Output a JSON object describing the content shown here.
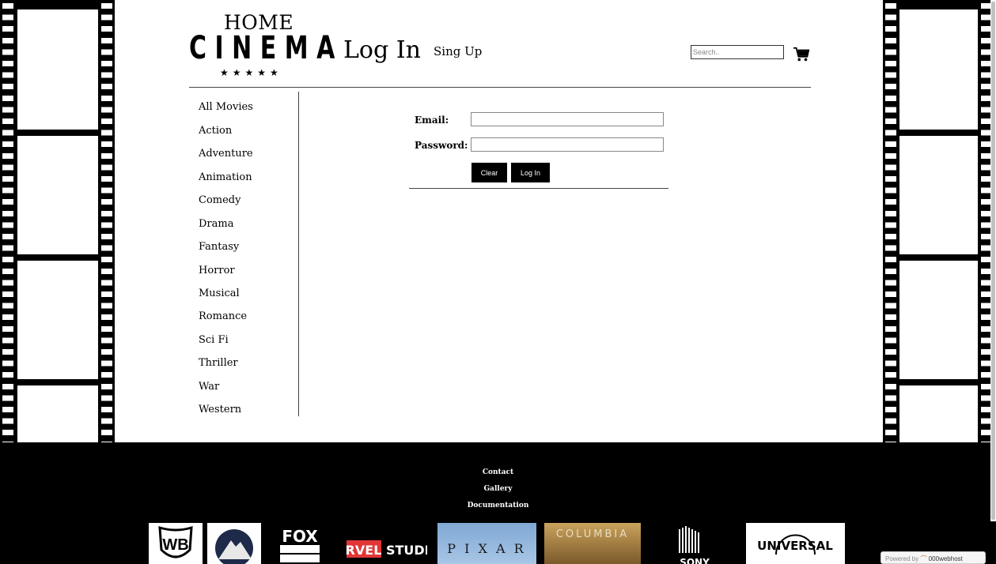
{
  "logo": {
    "line1": "HOME",
    "line2": "CINEMA",
    "stars": "★★★★★"
  },
  "nav": {
    "login": "Log In",
    "signup": "Sing Up"
  },
  "search": {
    "placeholder": "Search..",
    "icon": "cart-icon"
  },
  "categories": [
    "All Movies",
    "Action",
    "Adventure",
    "Animation",
    "Comedy",
    "Drama",
    "Fantasy",
    "Horror",
    "Musical",
    "Romance",
    "Sci Fi",
    "Thriller",
    "War",
    "Western"
  ],
  "form": {
    "email_label": "Email:",
    "password_label": "Password:",
    "email_value": "",
    "password_value": "",
    "clear_button": "Clear",
    "login_button": "Log In"
  },
  "footer": {
    "links": [
      "Contact",
      "Gallery",
      "Documentation"
    ],
    "studios": {
      "marvel": "MARVEL STUDIOS",
      "pixar": "P I X A R",
      "columbia": "COLUMBIA",
      "universal": "UNIVERSAL",
      "fox": "FOX",
      "sony": "SONY"
    }
  },
  "badge": {
    "text": "Powered by",
    "brand": "000webhost"
  },
  "colors": {
    "background": "#ffffff",
    "film": "#000000",
    "footer": "#000000"
  }
}
